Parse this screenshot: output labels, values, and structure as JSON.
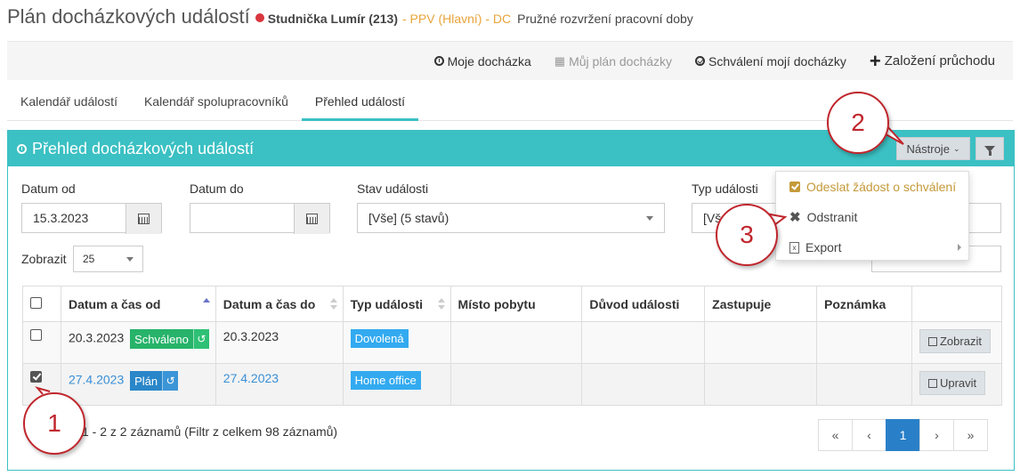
{
  "header": {
    "title": "Plán docházkových událostí",
    "user": "Studnička Lumír (213)",
    "department": "- PPV (Hlavní) - DC",
    "schedule": "Pružné rozvržení pracovní doby",
    "status_color": "#d9363e"
  },
  "topnav": {
    "moje_dochazka": "Moje docházka",
    "muj_plan": "Můj plán docházky",
    "schvaleni": "Schválení mojí docházky",
    "zalozeni": "Založení průchodu"
  },
  "tabs": [
    {
      "label": "Kalendář událostí"
    },
    {
      "label": "Kalendář spolupracovníků"
    },
    {
      "label": "Přehled událostí"
    }
  ],
  "panel": {
    "title": "Přehled docházkových událostí",
    "tools_label": "Nástroje",
    "accent": "#3bc0c3"
  },
  "filters": {
    "datum_od_label": "Datum od",
    "datum_od_value": "15.3.2023",
    "datum_do_label": "Datum do",
    "datum_do_value": "",
    "stav_label": "Stav události",
    "stav_value": "[Vše] (5 stavů)",
    "typ_label": "Typ události",
    "typ_value": "[Vš",
    "zobrazit_label": "Zobrazit",
    "zobrazit_value": "25"
  },
  "menu": {
    "items": [
      {
        "label": "Odeslat žádost o schválení"
      },
      {
        "label": "Odstranit"
      },
      {
        "label": "Export"
      }
    ]
  },
  "table": {
    "columns": [
      "Datum a čas od",
      "Datum a čas do",
      "Typ události",
      "Místo pobytu",
      "Důvod události",
      "Zastupuje",
      "Poznámka"
    ],
    "rows": [
      {
        "from": "20.3.2023",
        "state": "Schváleno",
        "to": "20.3.2023",
        "type": "Dovolená",
        "action": "Zobrazit",
        "checked": false
      },
      {
        "from": "27.4.2023",
        "state": "Plán",
        "to": "27.4.2023",
        "type": "Home office",
        "action": "Upravit",
        "checked": true
      }
    ]
  },
  "footer": {
    "info": "1 - 2 z 2 záznamů (Filtr z celkem 98 záznamů)",
    "pages": [
      "«",
      "‹",
      "1",
      "›",
      "»"
    ]
  },
  "annotations": [
    "1",
    "2",
    "3"
  ]
}
